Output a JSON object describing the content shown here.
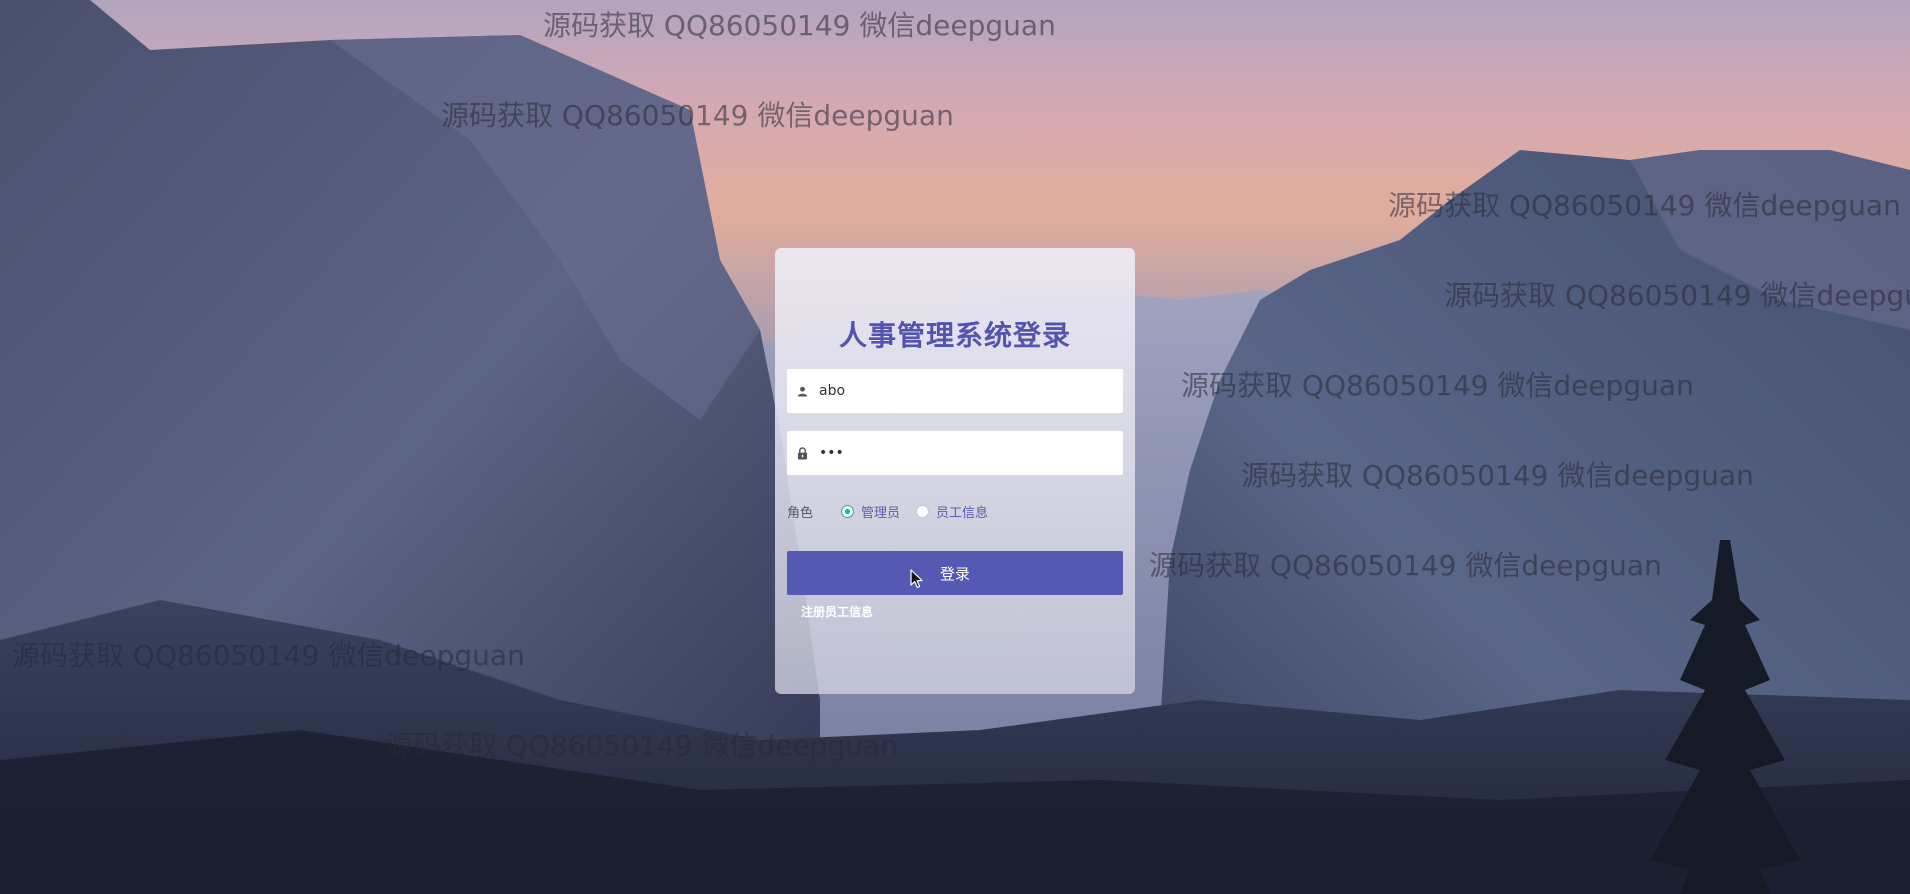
{
  "login": {
    "title": "人事管理系统登录",
    "username_value": "abo",
    "password_value": "123",
    "role_label": "角色",
    "roles": [
      {
        "label": "管理员",
        "checked": true
      },
      {
        "label": "员工信息",
        "checked": false
      }
    ],
    "submit_label": "登录",
    "register_label": "注册员工信息"
  },
  "watermark": {
    "text": "源码获取 QQ86050149 微信deepguan"
  },
  "icons": {
    "username": "user-icon",
    "password": "lock-icon",
    "cursor": "mouse-pointer-icon"
  },
  "colors": {
    "accent": "#5659b4",
    "title": "#5254b0",
    "radio_checked": "#17b38a"
  }
}
